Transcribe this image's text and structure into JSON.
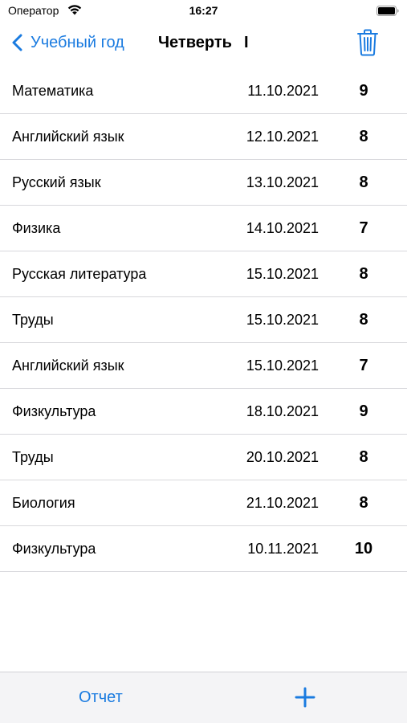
{
  "status_bar": {
    "carrier": "Оператор",
    "time": "16:27"
  },
  "nav": {
    "back_label": "Учебный год",
    "title": "Четверть",
    "title_value": "I"
  },
  "grades": [
    {
      "subject": "Математика",
      "date": "11.10.2021",
      "grade": "9"
    },
    {
      "subject": "Английский язык",
      "date": "12.10.2021",
      "grade": "8"
    },
    {
      "subject": "Русский язык",
      "date": "13.10.2021",
      "grade": "8"
    },
    {
      "subject": "Физика",
      "date": "14.10.2021",
      "grade": "7"
    },
    {
      "subject": "Русская литература",
      "date": "15.10.2021",
      "grade": "8"
    },
    {
      "subject": "Труды",
      "date": "15.10.2021",
      "grade": "8"
    },
    {
      "subject": "Английский язык",
      "date": "15.10.2021",
      "grade": "7"
    },
    {
      "subject": "Физкультура",
      "date": "18.10.2021",
      "grade": "9"
    },
    {
      "subject": "Труды",
      "date": "20.10.2021",
      "grade": "8"
    },
    {
      "subject": "Биология",
      "date": "21.10.2021",
      "grade": "8"
    },
    {
      "subject": "Физкультура",
      "date": "10.11.2021",
      "grade": "10"
    }
  ],
  "toolbar": {
    "report_label": "Отчет"
  },
  "icons": {
    "wifi": "wifi-icon",
    "battery": "battery-icon",
    "back": "chevron-left-icon",
    "trash": "trash-icon",
    "add": "plus-icon"
  },
  "colors": {
    "accent": "#1a7be0",
    "separator": "#d8d8dc",
    "toolbar_bg": "#f4f4f6"
  }
}
